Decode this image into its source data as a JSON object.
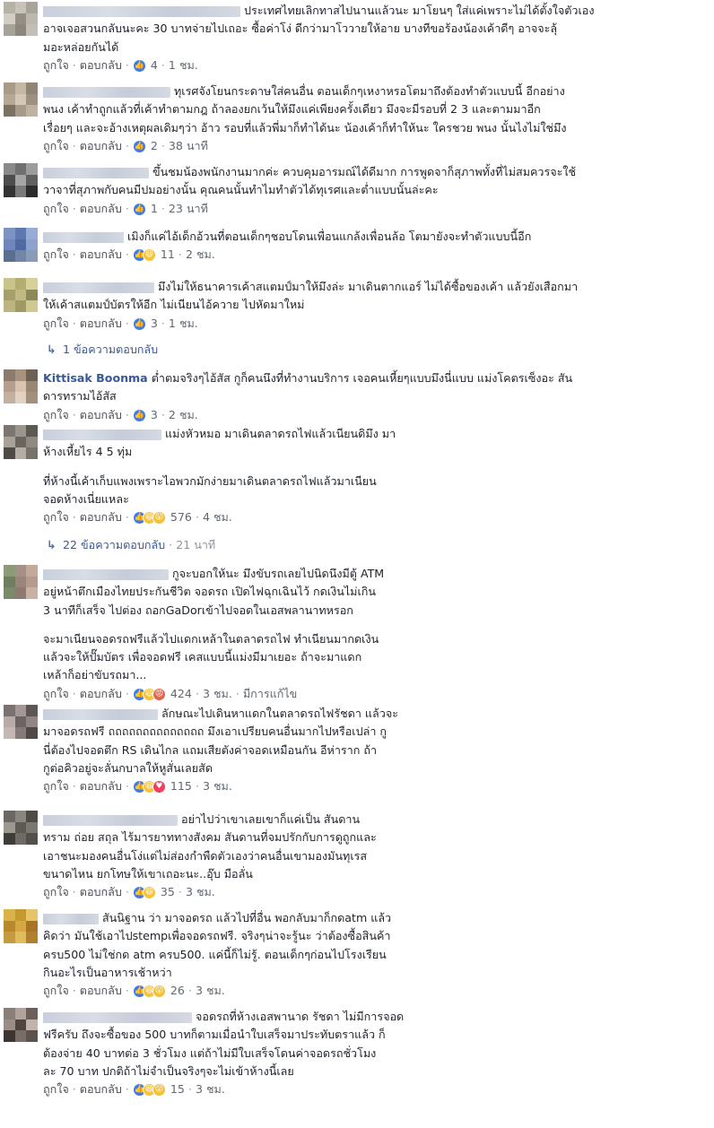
{
  "actions": {
    "like": "ถูกใจ",
    "reply": "ตอบกลับ"
  },
  "colors": {
    "link": "#385898",
    "meta": "#606770",
    "like": "#3b7cf0",
    "haha": "#f7c33a",
    "angry": "#e4654a"
  },
  "comments": [
    {
      "author": "",
      "lines": [
        "ประเทศไทยเลิกทาสไปนานแล้วนะ มาโยนๆ ใส่แค่เพราะไม่ได้ตั้งใจตัวเอง",
        "อาจเจอสวนกลับนะคะ 30 บาทจ่ายไปเถอะ ซื้อค่าโง่ ดีกว่ามาโววายให้อาย บางทีขอร้องน้องเค้าดีๆ อาจจะลุ้",
        "มอะหล่อยกันได้"
      ],
      "count": "4",
      "time": "1 ชม."
    },
    {
      "author": "",
      "lines": [
        "ทุเรศจังโยนกระดาษใส่คนอื่น ตอนเด็กๆเหงาหรอโตมาถึงต้องทำตัวแบบนี้ อีกอย่าง",
        "พนง เค้าทำถูกแล้วที่เค้าทำตามกฎ ถ้าลองยกเว้นให้มึงแค่เพียงครั้งเดียว มึงจะมีรอบที่ 2 3 และตามมาอีก",
        "เรื่อยๆ และจะอ้างเหตุผลเดิมๆว่า อ้าว รอบที่แล้วพี่มาก็ทำได้นะ น้องเค้าก็ทำให้นะ ใครชวย พนง นั้นไงไม่ใช่มึง"
      ],
      "count": "2",
      "time": "38 นาที"
    },
    {
      "author": "",
      "lines": [
        "ขึ้นชมน้องพนักงานมากค่ะ ควบคุมอารมณ์ได้ดีมาก การพูดจาก็สุภาพทั้งที่ไม่สมควรจะใช้",
        "วาจาที่สุภาพกับคนมีปมอย่างนั้น คุณคนนั้นทำไมทำตัวได้ทุเรศและต่ำแบบนั้นล่ะคะ"
      ],
      "count": "1",
      "time": "23 นาที"
    },
    {
      "author": "",
      "lines": [
        "เมิงก็แค่ไอ้เด็กอ้วนที่ตอนเด็กๆชอบโดนเพื่อนแกล้งเพื่อนล้อ โตมายังจะทำตัวแบบนี้อีก"
      ],
      "count": "11",
      "time": "2 ชม."
    },
    {
      "author": "",
      "lines": [
        "มึงไม่ให้ธนาคารเค้าสแตมป์มาให้มึงล่ะ มาเดินตากแอร์ ไม่ได้ซื้อของเค้า แล้วยังเสือกมา",
        "ให้เค้าสแตมป์บัตรให้อีก ไม่เนียนไอ้ควาย ไปหัดมาใหม่"
      ],
      "count": "3",
      "time": "1 ชม."
    },
    {
      "author": "Kittisak Boonma",
      "lines": [
        "ต่ำตมจริงๆไอ้สัส กูก็คนนึงที่ทำงานบริการ เจอคนเหี้ยๆแบบมึงนี่แบบ แม่งโคตรเซ็งอะ สัน",
        "ดารทรามไอ้สัส"
      ],
      "count": "3",
      "time": "2 ชม."
    },
    {
      "author": "",
      "lines": [
        "แม่งหัวหมอ มาเดินตลาดรถไฟแล้วเนียนดิมึง มา",
        "ห้างเหี้ยไร 4 5 ทุ่ม",
        "",
        "ที่ห้างนี้เค้าเก็บแพงเพราะไอพวกมักง่ายมาเดินตลาดรถไฟแล้วมาเนียน",
        "จอดห้างเนี่ยแหละ"
      ],
      "count": "576",
      "time": "4 ชม."
    },
    {
      "author": "",
      "lines": [
        "กูจะบอกให้นะ มึงขับรถเลยไปนิดนึงมีตู้ ATM",
        "อยู่หน้าตึกเมืองไทยประกันชีวิต จอดรถ เปิดไฟฉุกเฉินไว้ กดเงินไม่เกิน",
        "3 นาทีก็เสร็จ ไปต่อง ถอกGaDorเข้าไปจอดในเอสพลานาทหรอก",
        "",
        "จะมาเนียนจอดรถฟรีแล้วไปแดกเหล้าในตลาดรถไฟ ทำเนียนมากดเงิน",
        "แล้วจะให้ปั๊มบัตร เพื่อจอดฟรี เคสแบบนี้แม่งมีมาเยอะ ถ้าจะมาแดก",
        "เหล้าก็อย่าขับรถมา..."
      ],
      "count": "424",
      "time": "3 ชม.",
      "edited": "มีการแก้ไข"
    },
    {
      "author": "",
      "lines": [
        "ลักษณะไปเดินหาแดกในตลาดรถไฟรัชดา แล้วจะ",
        "มาจอดรถฟรี ถถถถถถถถถถถถถถ มึงเอาเปรียบคนอื่นมากไปหรือเปล่า กู",
        "นี่ต้องไปจอดตึก RS เดินไกล แถมเสียตังค่าจอดเหมือนกัน อีห่าราก ถ้า",
        "กูต่อคิวอยู่จะลั่นกบาลให้หูสั่นเลยสัด"
      ],
      "count": "115",
      "time": "3 ชม."
    },
    {
      "author": "",
      "lines": [
        "อย่าไปว่าเขาเลยเขาก็แค่เป็น สันดาน",
        "ทราม ถ่อย สถุล ไร้มารยาททางสังคม สันดานที่จมปรักกับการดูถูกและ",
        "เอาชนะมองคนอื่นโง่แต่ไม่ส่องกำพืดตัวเองว่าคนอื่นเขามองมันทุเรส",
        "ขนาดไหน ยกโทษให้เขาเถอะนะ..อุ๊บ มือลั่น"
      ],
      "count": "35",
      "time": "3 ชม."
    },
    {
      "author": "",
      "lines": [
        "สันนิฐาน ว่า มาจอดรถ แล้วไปที่อื่น พอกลับมาก็กดatm แล้ว",
        "คิดว่า มันใช้เอาไปstempเพื่อจอดรถฟรี. จริงๆน่าจะรู้นะ ว่าต้องซื้อสินค้า",
        "ครบ500 ไม่ใช่กด atm ครบ500. แค่นี้ก็ไม่รู้. ตอนเด็กๆก่อนไปโรงเรียน",
        "กินอะไรเป็นอาหารเช้าหว่า"
      ],
      "count": "26",
      "time": "3 ชม."
    },
    {
      "author": "",
      "lines": [
        "จอดรถที่ห้างเอสพานาด รัชดา ไม่มีการจอด",
        "ฟรีครับ ถึงจะซื้อของ 500 บาทก็ตามเมื่อนำใบเสร็จมาประทับตราแล้ว ก็",
        "ต้องจ่าย 40 บาทต่อ 3 ชั่วโมง แต่ถ้าไม่มีใบเสร็จโดนค่าจอดรถชั่วโมง",
        "ละ 70 บาท ปกติถ้าไม่จำเป็นจริงๆจะไม่เข้าห้างนี้เลย"
      ],
      "count": "15",
      "time": "3 ชม."
    }
  ],
  "replies": [
    {
      "label": "1 ข้อความตอบกลับ",
      "time": ""
    },
    {
      "label": "22 ข้อความตอบกลับ",
      "time": "21 นาที"
    }
  ]
}
